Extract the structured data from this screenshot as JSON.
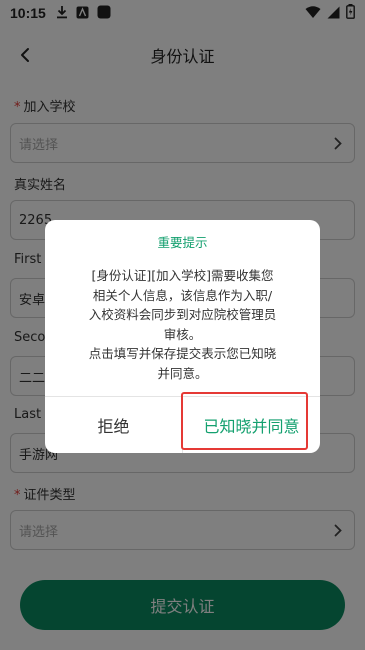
{
  "status_bar": {
    "time": "10:15"
  },
  "nav": {
    "title": "身份认证"
  },
  "form": {
    "school": {
      "label": "加入学校",
      "placeholder": "请选择"
    },
    "real_name": {
      "label": "真实姓名",
      "value": "2265"
    },
    "first_name": {
      "label": "First N",
      "value": "安卓网"
    },
    "second_name": {
      "label": "Secon",
      "value": "二二六"
    },
    "last_name": {
      "label": "Last N",
      "value": "手游网"
    },
    "id_type": {
      "label": "证件类型",
      "placeholder": "请选择"
    },
    "required_mark": "*"
  },
  "submit": {
    "label": "提交认证"
  },
  "dialog": {
    "title": "重要提示",
    "message_lines": [
      "[身份认证][加入学校]需要收集您",
      "相关个人信息，该信息作为入职/",
      "入校资料会同步到对应院校管理员",
      "审核。",
      "点击填写并保存提交表示您已知晓",
      "并同意。"
    ],
    "reject_label": "拒绝",
    "agree_label": "已知晓并同意"
  },
  "colors": {
    "accent": "#14a06f",
    "button": "#0b8a60",
    "required": "#e53935",
    "highlight": "#e53935"
  }
}
